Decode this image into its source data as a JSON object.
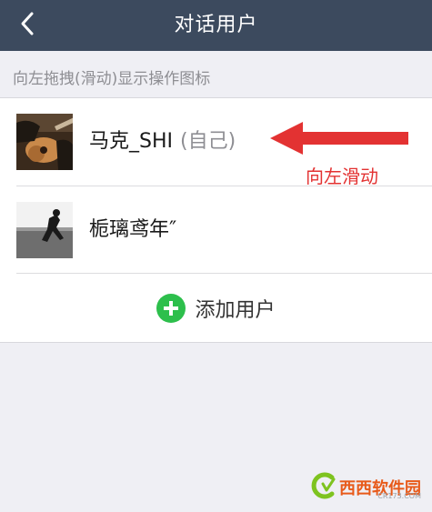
{
  "navbar": {
    "title": "对话用户",
    "back_icon": "chevron-left-icon"
  },
  "hint": {
    "text": "向左拖拽(滑动)显示操作图标"
  },
  "users": [
    {
      "name": "马克_SHI",
      "tag": "(自己)",
      "avatar": "guitar-photo"
    },
    {
      "name": "栀璃鸢年″",
      "tag": "",
      "avatar": "silhouette-photo"
    }
  ],
  "annotation": {
    "text": "向左滑动",
    "color": "#e33232"
  },
  "add_user": {
    "label": "添加用户",
    "icon": "plus-circle-icon",
    "color": "#2dbf4c"
  },
  "watermark": {
    "text": "西西软件园",
    "sub": "CR173.COM"
  },
  "colors": {
    "navbar": "#3c4a5e",
    "background": "#efeff4"
  }
}
